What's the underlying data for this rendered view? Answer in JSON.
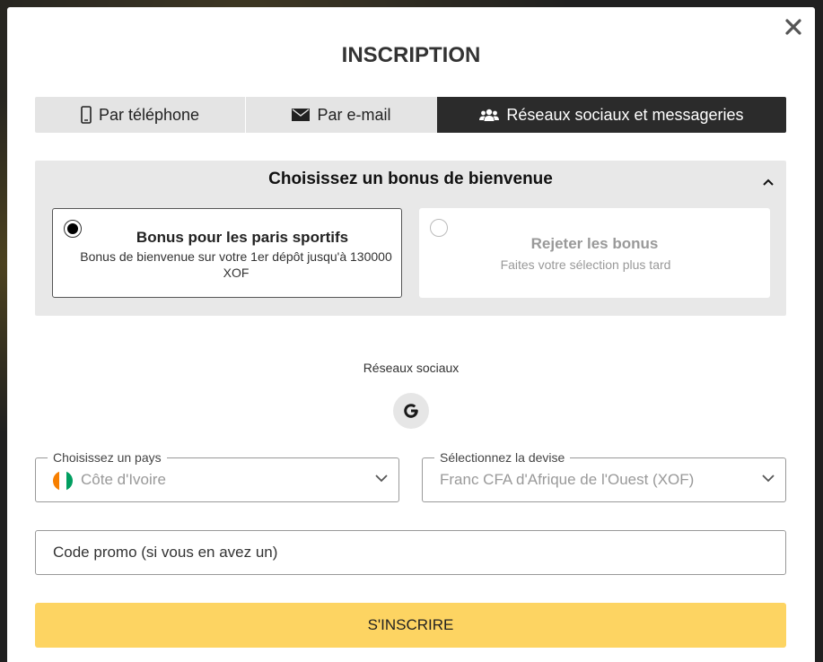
{
  "modal": {
    "title": "INSCRIPTION",
    "close_icon": "close-icon"
  },
  "tabs": [
    {
      "label": "Par téléphone",
      "icon": "phone-icon",
      "active": false
    },
    {
      "label": "Par e-mail",
      "icon": "envelope-icon",
      "active": false
    },
    {
      "label": "Réseaux sociaux et messageries",
      "icon": "users-icon",
      "active": true
    }
  ],
  "bonus": {
    "header": "Choisissez un bonus de bienvenue",
    "options": [
      {
        "title": "Bonus pour les paris sportifs",
        "subtitle": "Bonus de bienvenue sur votre 1er dépôt jusqu'à 130000 XOF",
        "selected": true
      },
      {
        "title": "Rejeter les bonus",
        "subtitle": "Faites votre sélection plus tard",
        "selected": false
      }
    ]
  },
  "social": {
    "label": "Réseaux sociaux",
    "providers": [
      {
        "name": "Google",
        "icon": "google-icon"
      }
    ]
  },
  "country": {
    "label": "Choisissez un pays",
    "value": "Côte d'Ivoire",
    "flag_colors": [
      "#f77f00",
      "#ffffff",
      "#009e60"
    ]
  },
  "currency": {
    "label": "Sélectionnez la devise",
    "value": "Franc CFA d'Afrique de l'Ouest (XOF)"
  },
  "promo": {
    "placeholder": "Code promo (si vous en avez un)"
  },
  "submit": {
    "label": "S'INSCRIRE",
    "color": "#fdd462"
  }
}
